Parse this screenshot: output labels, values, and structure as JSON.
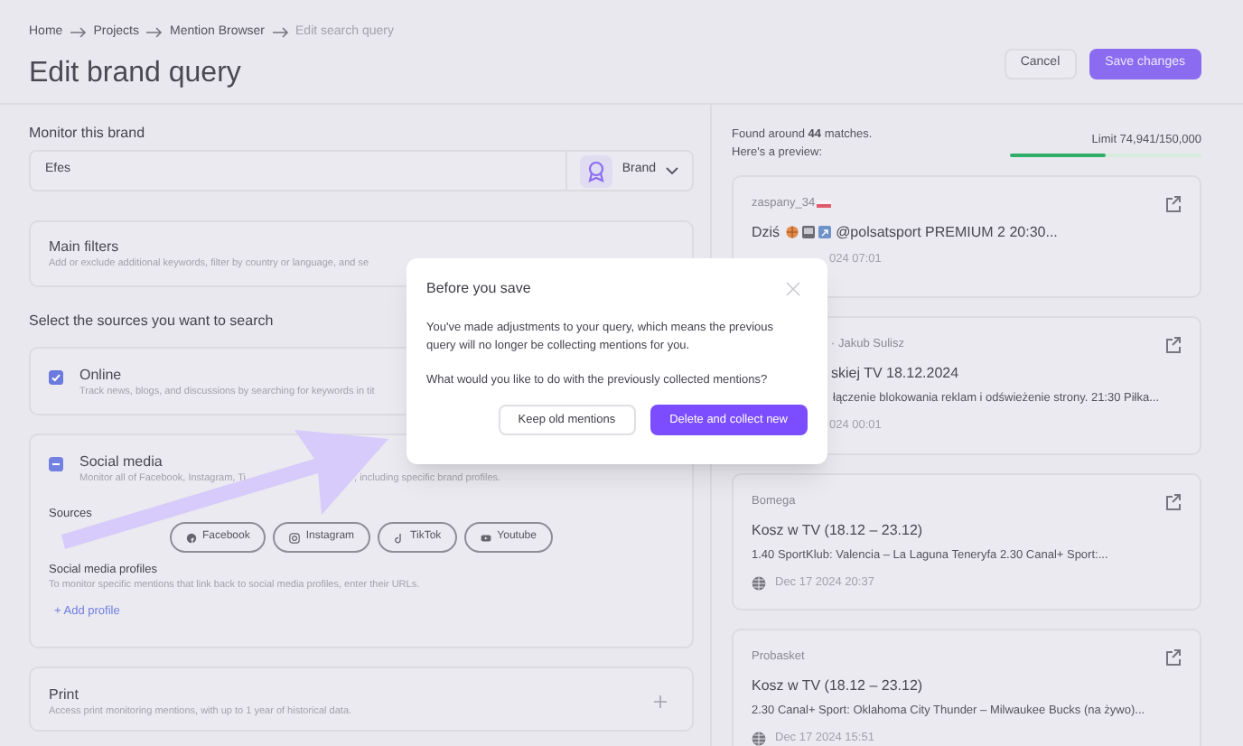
{
  "breadcrumb": [
    {
      "label": "Home",
      "current": false
    },
    {
      "label": "Projects",
      "current": false
    },
    {
      "label": "Mention Browser",
      "current": false
    },
    {
      "label": "Edit search query",
      "current": true
    }
  ],
  "page_title": "Edit brand query",
  "actions": {
    "cancel": "Cancel",
    "save": "Save changes"
  },
  "brand": {
    "label": "Monitor this brand",
    "value": "Efes",
    "type": "Brand"
  },
  "main_filters": {
    "title": "Main filters",
    "description": "Add or exclude additional keywords, filter by country or language, and se"
  },
  "sources_heading": "Select the sources you want to search",
  "sources": [
    {
      "kind": "online",
      "title": "Online",
      "description": "Track news, blogs, and discussions by searching for keywords in tit",
      "checked": true
    },
    {
      "kind": "social",
      "title": "Social media",
      "description_start": "Monitor all of Facebook, Instagram, Ti",
      "description_end": ", including specific brand profiles.",
      "partial": true,
      "sources_label": "Sources",
      "platforms": [
        {
          "kind": "facebook",
          "label": "Facebook"
        },
        {
          "kind": "instagram",
          "label": "Instagram"
        },
        {
          "kind": "tiktok",
          "label": "TikTok"
        },
        {
          "kind": "youtube",
          "label": "Youtube"
        }
      ],
      "profiles_title": "Social media profiles",
      "profiles_hint": "To monitor specific mentions that link back to social media profiles, enter their URLs.",
      "add_profile": "+ Add profile"
    },
    {
      "kind": "print",
      "title": "Print",
      "description": "Access print monitoring mentions, with up to 1 year of historical data."
    }
  ],
  "preview": {
    "found": "Found around **44** matches.",
    "subtitle": "Here's a preview:",
    "limit": "Limit 74,941/150,000",
    "level": 0.5
  },
  "mentions": [
    {
      "kind": "date_covered",
      "author": "zaspany_34",
      "title_start": "Dziś",
      "title_end": "@polsatsport PREMIUM 2 20:30...",
      "date": "024 07:01"
    },
    {
      "kind": "covered",
      "author": "· Jakub Sulisz",
      "title": "skiej TV 18.12.2024",
      "snippet": "łączenie blokowania reklam i odświeżenie strony. 21:30 Piłka...",
      "date": "024 00:01"
    },
    {
      "kind": "full",
      "author": "Bomega",
      "title": "Kosz w TV (18.12 – 23.12)",
      "snippet": "1.40 SportKlub: Valencia – La Laguna Teneryfa 2.30 Canal+ Sport:...",
      "date": "Dec 17 2024 20:37"
    },
    {
      "kind": "full",
      "author": "Probasket",
      "title": "Kosz w TV (18.12 – 23.12)",
      "snippet": "2.30 Canal+ Sport: Oklahoma City Thunder – Milwaukee Bucks (na żywo)...",
      "date": "Dec 17 2024 15:51"
    }
  ],
  "dialog": {
    "title": "Before you save",
    "message": "You've made adjustments to your query, which means the previous query will no longer be collecting mentions for you.",
    "question": "What would you like to do with the previously collected mentions?",
    "secondary": "Keep old mentions",
    "primary": "Delete and collect new"
  }
}
